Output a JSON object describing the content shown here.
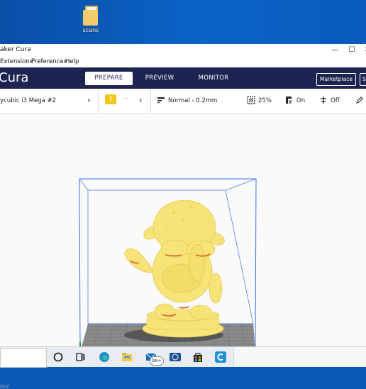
{
  "desktop": {
    "icon_label": "scans"
  },
  "window": {
    "title": "aker Cura",
    "controls": {
      "minimize": "—",
      "maximize": "☐",
      "close": "✕"
    }
  },
  "menu": {
    "extensions": "Extensions",
    "preferences": "Preferences",
    "help": "Help"
  },
  "header": {
    "logo": "Cura",
    "tabs": [
      "PREPARE",
      "PREVIEW",
      "MONITOR"
    ],
    "active_tab": "PREPARE",
    "marketplace": "Marketplace",
    "signin_partial": "S"
  },
  "toolbar": {
    "printer": "ycubic i3 Mega #2",
    "warning_count": "!",
    "ellipsis": "···",
    "profile": "Normal - 0.2mm",
    "infill": "25%",
    "support": "On",
    "adhesion": "Off"
  },
  "viewport": {
    "footer_text": "ppy"
  },
  "taskbar": {
    "badge": "99+"
  },
  "colors": {
    "header_bg": "#1e2452",
    "model": "#f7e479",
    "build_volume": "#3d6ff0",
    "plate": "#7d7d7d"
  }
}
